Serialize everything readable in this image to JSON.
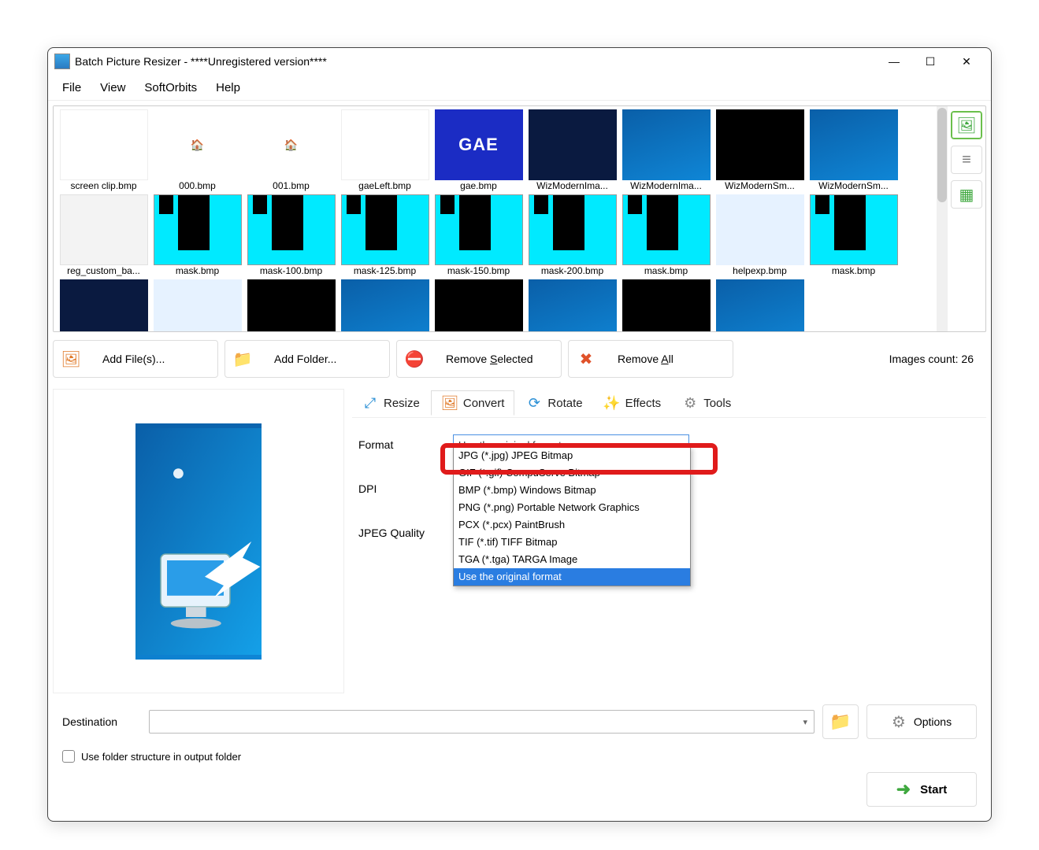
{
  "window": {
    "title": "Batch Picture Resizer - ****Unregistered version****"
  },
  "menu": {
    "file": "File",
    "view": "View",
    "softorbits": "SoftOrbits",
    "help": "Help"
  },
  "side": {
    "images": "🖼",
    "list": "≣",
    "table": "▦"
  },
  "thumbs": [
    {
      "name": "screen clip.bmp",
      "style": "plain"
    },
    {
      "name": "000.bmp",
      "style": "icongrid"
    },
    {
      "name": "001.bmp",
      "style": "icongrid"
    },
    {
      "name": "gaeLeft.bmp",
      "style": "plain"
    },
    {
      "name": "gae.bmp",
      "style": "gae"
    },
    {
      "name": "WizModernIma...",
      "style": "dark"
    },
    {
      "name": "WizModernIma...",
      "style": "blue"
    },
    {
      "name": "WizModernSm...",
      "style": "blackimg"
    },
    {
      "name": "WizModernSm...",
      "style": "blue"
    },
    {
      "name": "reg_custom_ba...",
      "style": "grey"
    },
    {
      "name": "mask.bmp",
      "style": "mask"
    },
    {
      "name": "mask-100.bmp",
      "style": "mask"
    },
    {
      "name": "mask-125.bmp",
      "style": "mask"
    },
    {
      "name": "mask-150.bmp",
      "style": "mask"
    },
    {
      "name": "mask-200.bmp",
      "style": "mask"
    },
    {
      "name": "mask.bmp",
      "style": "mask"
    },
    {
      "name": "helpexp.bmp",
      "style": "helppx"
    },
    {
      "name": "mask.bmp",
      "style": "mask"
    },
    {
      "name": "",
      "style": "dark"
    },
    {
      "name": "",
      "style": "helppx"
    },
    {
      "name": "",
      "style": "blackimg"
    },
    {
      "name": "",
      "style": "blue"
    },
    {
      "name": "",
      "style": "blackimg"
    },
    {
      "name": "",
      "style": "blue"
    },
    {
      "name": "",
      "style": "blackimg"
    },
    {
      "name": "",
      "style": "blue"
    }
  ],
  "toolbar": {
    "add_files": "Add File(s)...",
    "add_folder": "Add Folder...",
    "remove_selected_pre": "Remove ",
    "remove_selected_u": "S",
    "remove_selected_post": "elected",
    "remove_all_pre": "Remove ",
    "remove_all_u": "A",
    "remove_all_post": "ll",
    "count_label": "Images count: 26"
  },
  "tabs": {
    "resize": "Resize",
    "convert": "Convert",
    "rotate": "Rotate",
    "effects": "Effects",
    "tools": "Tools"
  },
  "convert": {
    "format_label": "Format",
    "dpi_label": "DPI",
    "quality_label": "JPEG Quality",
    "selected": "Use the original format",
    "options": [
      "JPG (*.jpg) JPEG Bitmap",
      "GIF (*.gif) CompuServe Bitmap",
      "BMP (*.bmp) Windows Bitmap",
      "PNG (*.png) Portable Network Graphics",
      "PCX (*.pcx) PaintBrush",
      "TIF (*.tif) TIFF Bitmap",
      "TGA (*.tga) TARGA Image",
      "Use the original format"
    ]
  },
  "bottom": {
    "destination": "Destination",
    "use_folder": "Use folder structure in output folder",
    "options": "Options",
    "start": "Start"
  }
}
